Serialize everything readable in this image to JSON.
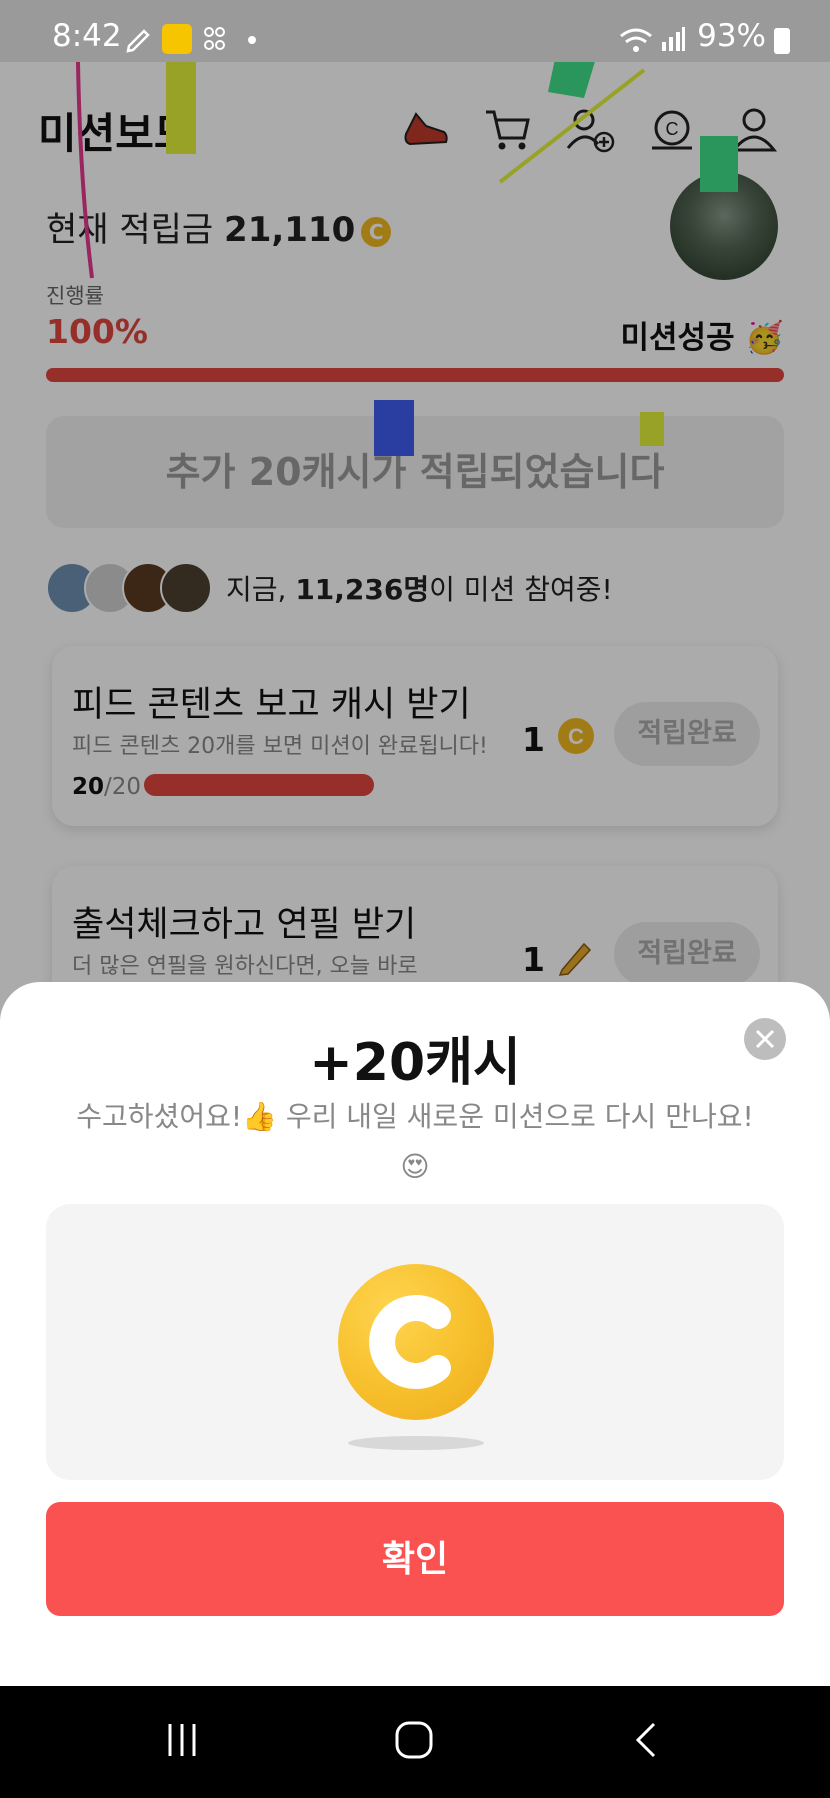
{
  "status_bar": {
    "time": "8:42",
    "battery": "93%"
  },
  "header": {
    "title": "미션보드",
    "icons": [
      "sneaker-icon",
      "cart-icon",
      "add-friend-icon",
      "coin-icon",
      "profile-icon"
    ]
  },
  "balance": {
    "label": "현재 적립금",
    "amount": "21,110",
    "coin_glyph": "C"
  },
  "progress": {
    "label": "진행률",
    "value": "100%",
    "fraction": 1.0,
    "status": "미션성공 🥳"
  },
  "notice": "추가 20캐시가 적립되었습니다",
  "participants": {
    "prefix": "지금, ",
    "count": "11,236명",
    "suffix": "이 미션 참여중!"
  },
  "missions": [
    {
      "title": "피드 콘텐츠 보고 캐시 받기",
      "desc": "피드 콘텐츠 20개를 보면 미션이 완료됩니다!",
      "count_done": "20",
      "count_total": "/20",
      "reward": "1",
      "reward_icon": "coin-icon",
      "button": "적립완료"
    },
    {
      "title": "출석체크하고 연필 받기",
      "desc": "더 많은 연필을 원하신다면, 오늘 바로",
      "reward": "1",
      "reward_icon": "pencil-icon",
      "button": "적립완료"
    }
  ],
  "sheet": {
    "title": "+20캐시",
    "message_line1": "수고하셨어요!👍 우리 내일 새로운 미션으로 다시 만나요!",
    "message_line2": "😍",
    "confirm": "확인"
  },
  "colors": {
    "accent_red": "#e0453f",
    "confirm_red": "#fa5151",
    "coin_gold": "#f6bf2b"
  }
}
